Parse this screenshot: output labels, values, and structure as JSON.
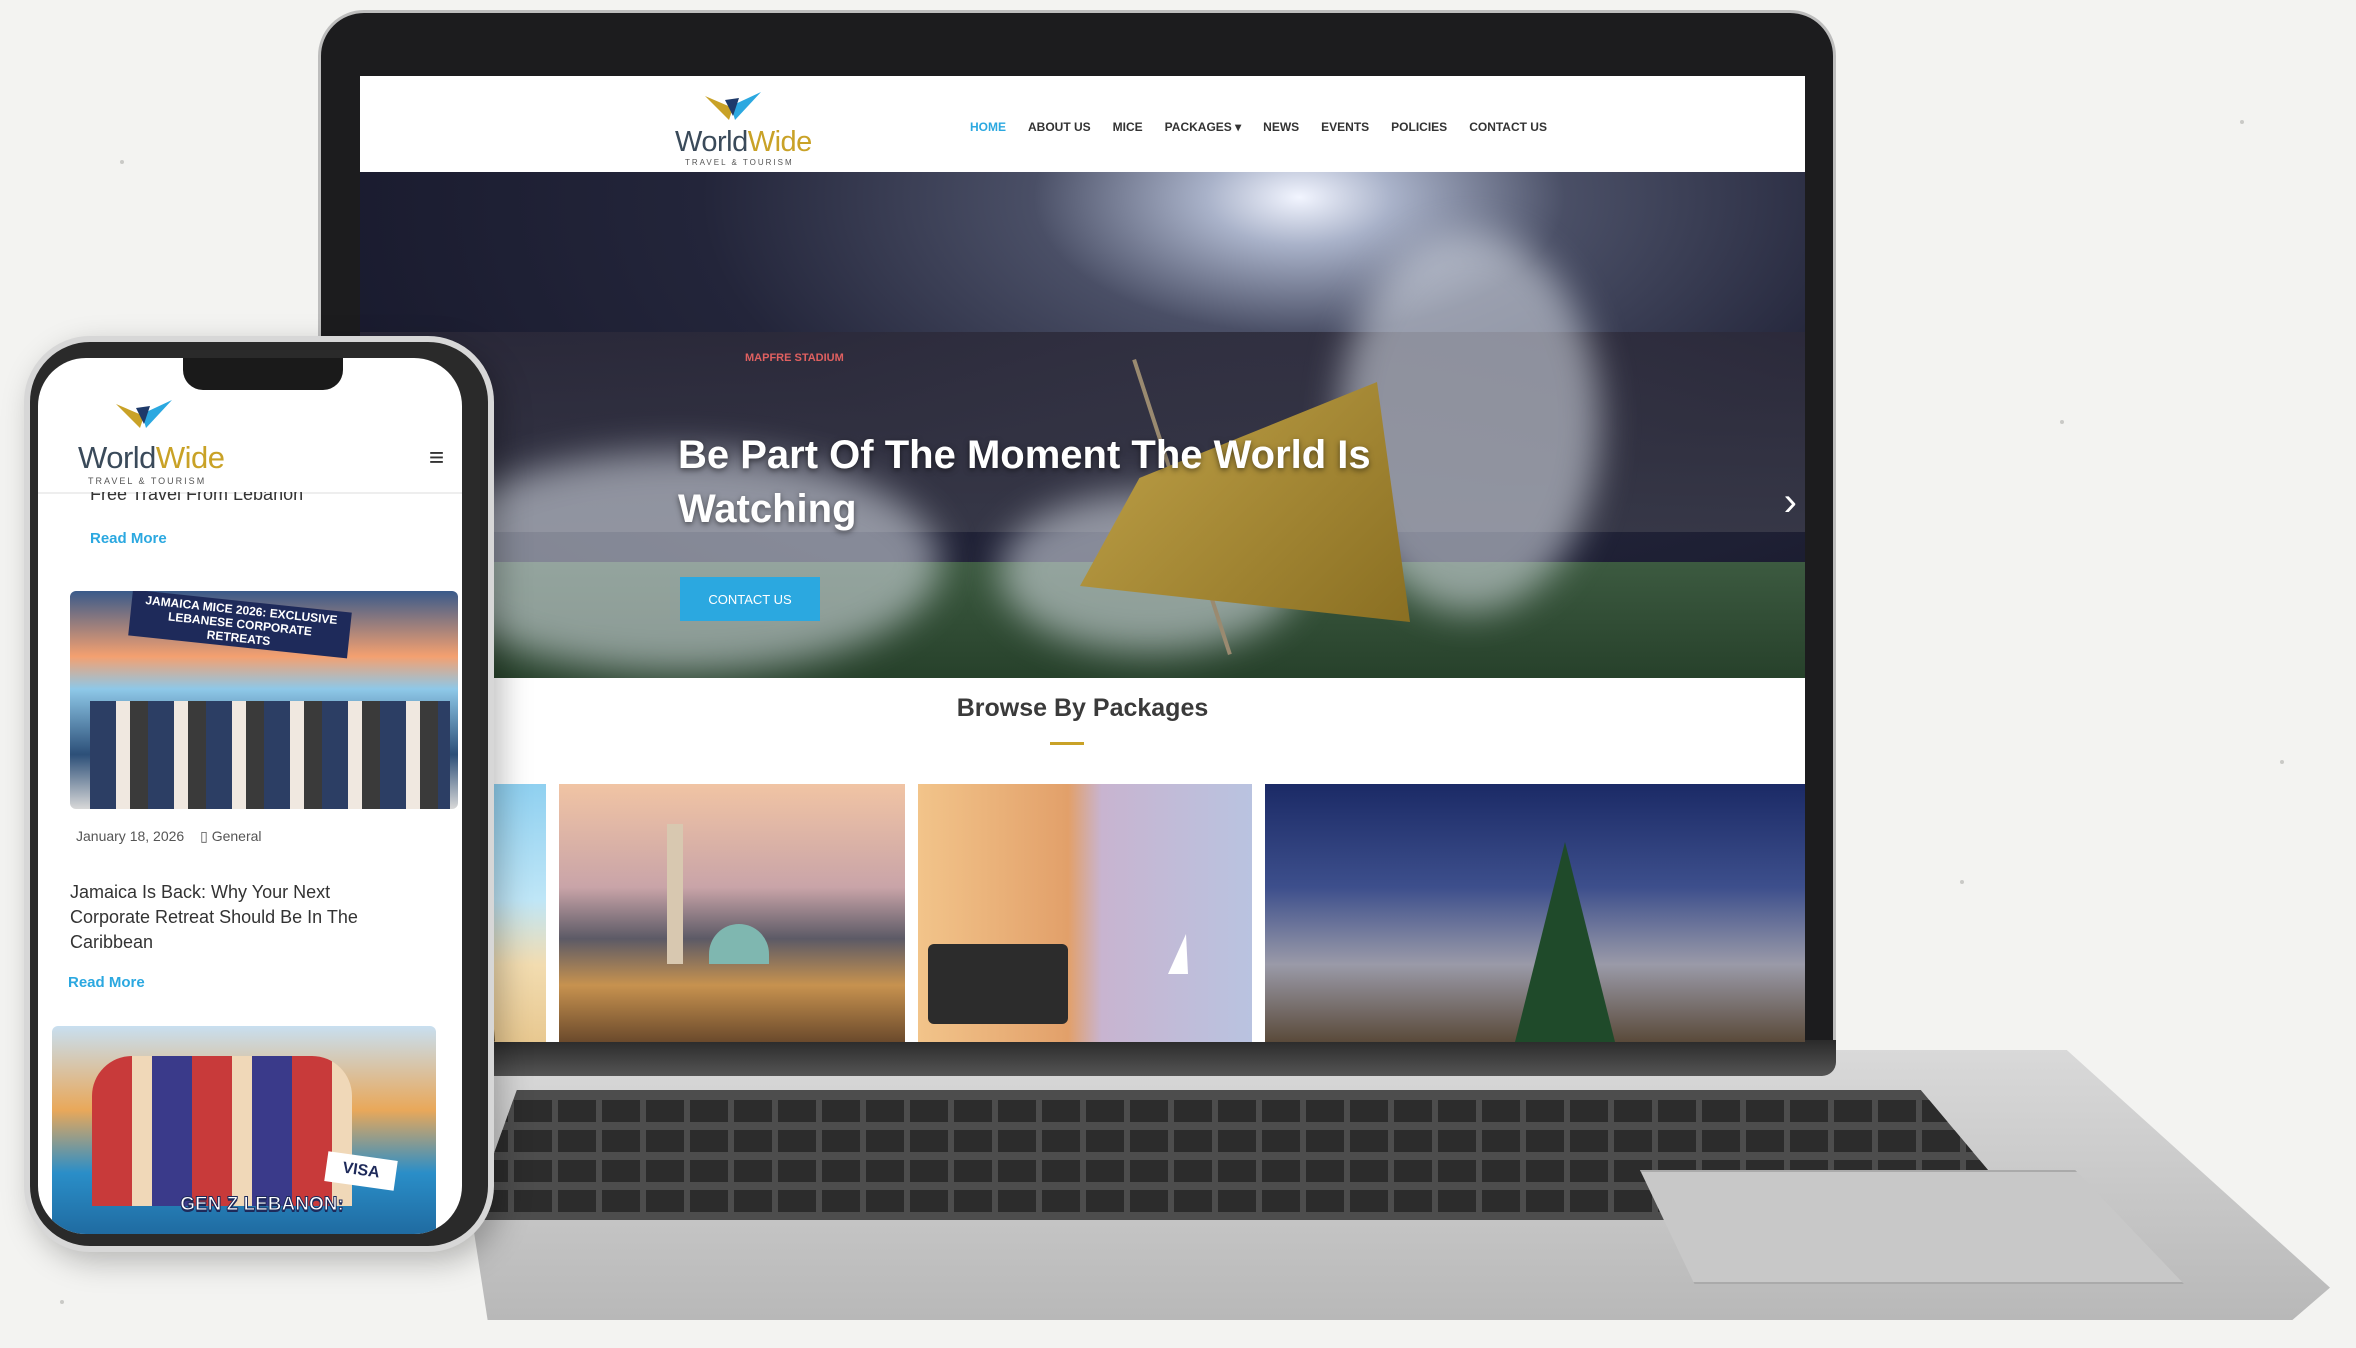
{
  "brand": {
    "name_part1": "World",
    "name_part2": "Wide",
    "tagline": "TRAVEL & TOURISM"
  },
  "nav": {
    "items": [
      {
        "label": "HOME",
        "active": true
      },
      {
        "label": "ABOUT US",
        "active": false
      },
      {
        "label": "MICE",
        "active": false
      },
      {
        "label": "PACKAGES ▾",
        "active": false
      },
      {
        "label": "NEWS",
        "active": false
      },
      {
        "label": "EVENTS",
        "active": false
      },
      {
        "label": "POLICIES",
        "active": false
      },
      {
        "label": "CONTACT US",
        "active": false
      }
    ]
  },
  "hero": {
    "title": "Be Part Of The Moment The World Is Watching",
    "cta": "CONTACT US",
    "next_icon": "chevron-right-icon",
    "stadium_sign": "MAPFRE STADIUM"
  },
  "packages": {
    "title": "Browse By Packages"
  },
  "mobile": {
    "menu_icon": "hamburger-icon",
    "prev_post_fragment": "Free Travel From Lebanon",
    "read_more_1": "Read More ",
    "post_banner": "JAMAICA MICE 2026: EXCLUSIVE LEBANESE CORPORATE RETREATS",
    "post_date": "January 18, 2026",
    "post_category": " General",
    "post_title": "Jamaica Is Back: Why Your Next Corporate Retreat Should Be In The Caribbean",
    "read_more_2": "Read More ",
    "next_post_banner": "GEN Z LEBANON:",
    "next_post_visa": "VISA"
  },
  "colors": {
    "accent": "#2ba8e0",
    "gold": "#c9a227",
    "text_dark": "#333333"
  }
}
